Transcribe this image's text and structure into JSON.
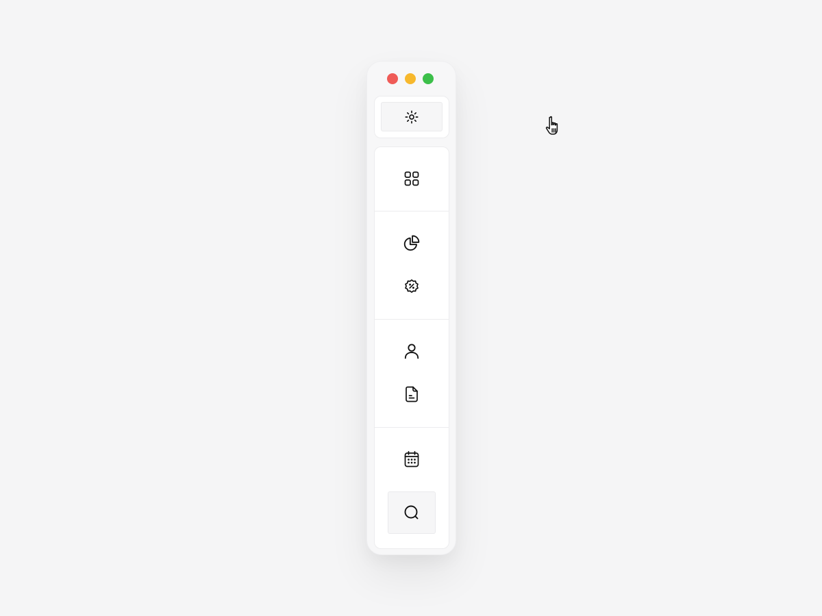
{
  "window": {
    "controls": [
      "close",
      "minimize",
      "zoom"
    ],
    "colors": {
      "close": "#ef5b57",
      "minimize": "#f7b82d",
      "zoom": "#3cbf4a"
    }
  },
  "theme_toggle": {
    "icon": "sun-icon"
  },
  "nav": {
    "groups": [
      {
        "items": [
          {
            "icon": "grid-icon"
          }
        ]
      },
      {
        "items": [
          {
            "icon": "pie-chart-icon"
          },
          {
            "icon": "discount-badge-icon"
          }
        ]
      },
      {
        "items": [
          {
            "icon": "user-icon"
          },
          {
            "icon": "document-icon"
          }
        ]
      },
      {
        "items": [
          {
            "icon": "calendar-icon"
          },
          {
            "icon": "search-icon",
            "active": true
          }
        ]
      }
    ]
  },
  "cursor": {
    "icon": "hand-pointer-icon"
  }
}
